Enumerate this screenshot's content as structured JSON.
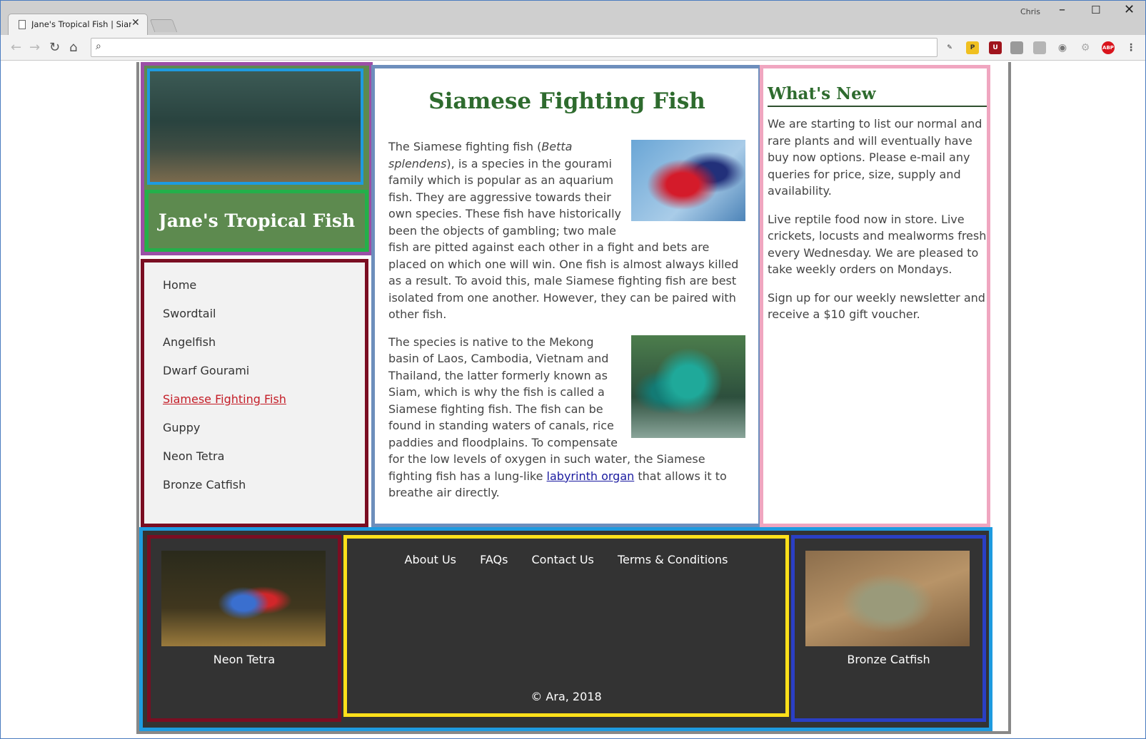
{
  "browser": {
    "tab_title": "Jane's Tropical Fish | Siamese Fighting Fish",
    "profile_name": "Chris",
    "address": ""
  },
  "site": {
    "brand": "Jane's Tropical Fish",
    "nav": [
      {
        "label": "Home",
        "active": false
      },
      {
        "label": "Swordtail",
        "active": false
      },
      {
        "label": "Angelfish",
        "active": false
      },
      {
        "label": "Dwarf Gourami",
        "active": false
      },
      {
        "label": "Siamese Fighting Fish",
        "active": true
      },
      {
        "label": "Guppy",
        "active": false
      },
      {
        "label": "Neon Tetra",
        "active": false
      },
      {
        "label": "Bronze Catfish",
        "active": false
      }
    ]
  },
  "main": {
    "title": "Siamese Fighting Fish",
    "p1_pre": "The Siamese fighting fish (",
    "p1_italic": "Betta splendens",
    "p1_post": "), is a species in the gourami family which is popular as an aquarium fish. They are aggressive towards their own species. These fish have historically been the objects of gambling; two male fish are pitted against each other in a fight and bets are placed on which one will win. One fish is almost always killed as a result. To avoid this, male Siamese fighting fish are best isolated from one another. However, they can be paired with other fish.",
    "p2_pre": "The species is native to the Mekong basin of Laos, Cambodia, Vietnam and Thailand, the latter formerly known as Siam, which is why the fish is called a Siamese fighting fish. The fish can be found in standing waters of canals, rice paddies and floodplains. To compensate for the low levels of oxygen in such water, the Siamese fighting fish has a lung-like ",
    "p2_link": "labyrinth organ",
    "p2_post": " that allows it to breathe air directly."
  },
  "news": {
    "title": "What's New",
    "items": [
      "We are starting to list our normal and rare plants and will eventually have buy now options. Please e-mail any queries for price, size, supply and availability.",
      "Live reptile food now in store. Live crickets, locusts and mealworms fresh every Wednesday. We are pleased to take weekly orders on Mondays.",
      "Sign up for our weekly newsletter and receive a $10 gift voucher."
    ]
  },
  "footer": {
    "left_caption": "Neon Tetra",
    "right_caption": "Bronze Catfish",
    "links": [
      "About Us",
      "FAQs",
      "Contact Us",
      "Terms & Conditions"
    ],
    "copyright": "© Ara, 2018"
  },
  "colors": {
    "heading_green": "#2e6b2e",
    "brand_green": "#5d8a4f",
    "active_link": "#c41e28",
    "footer_bg": "#333333"
  }
}
